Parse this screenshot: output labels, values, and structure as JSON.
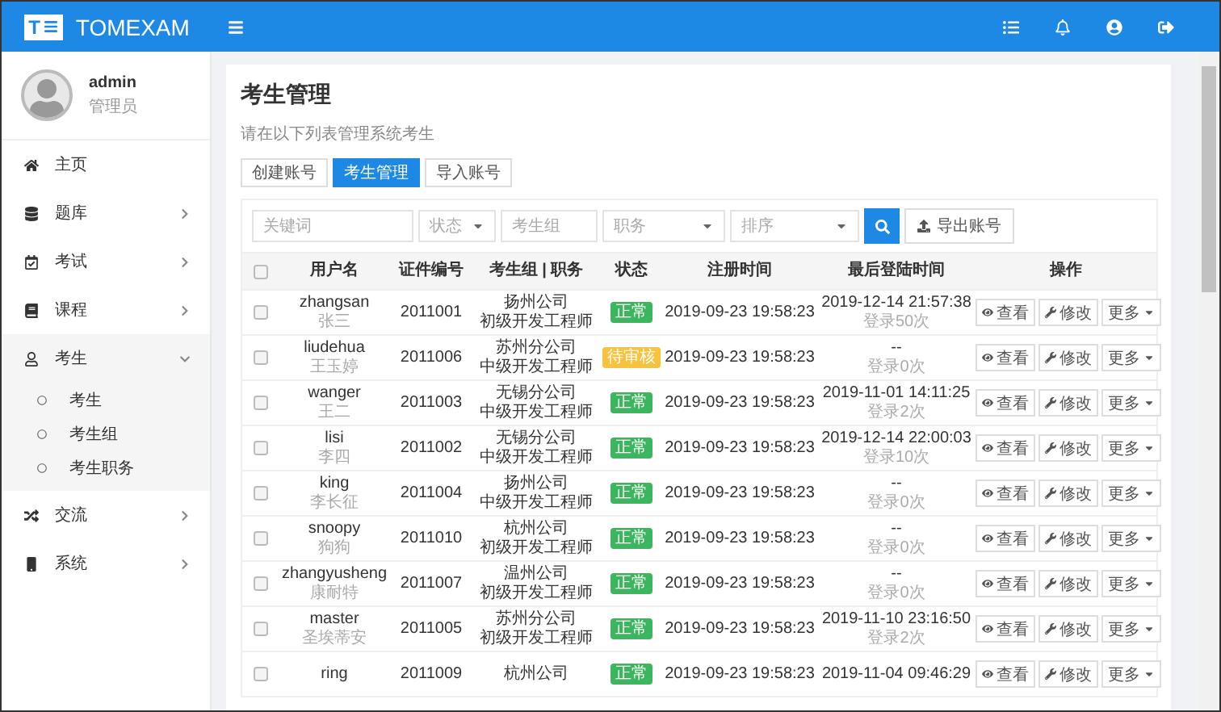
{
  "topbar": {
    "logo": "T",
    "brand": "TOMEXAM"
  },
  "sidebar": {
    "user": {
      "name": "admin",
      "role": "管理员"
    },
    "items": [
      {
        "label": "主页",
        "has_arrow": false
      },
      {
        "label": "题库",
        "has_arrow": true,
        "expanded": false
      },
      {
        "label": "考试",
        "has_arrow": true,
        "expanded": false
      },
      {
        "label": "课程",
        "has_arrow": true,
        "expanded": false
      },
      {
        "label": "考生",
        "has_arrow": true,
        "expanded": true,
        "children": [
          {
            "label": "考生"
          },
          {
            "label": "考生组"
          },
          {
            "label": "考生职务"
          }
        ]
      },
      {
        "label": "交流",
        "has_arrow": true,
        "expanded": false
      },
      {
        "label": "系统",
        "has_arrow": true,
        "expanded": false
      }
    ]
  },
  "page": {
    "title": "考生管理",
    "subtitle": "请在以下列表管理系统考生"
  },
  "tabs": [
    {
      "label": "创建账号",
      "selected": false
    },
    {
      "label": "考生管理",
      "selected": true
    },
    {
      "label": "导入账号",
      "selected": false
    }
  ],
  "filters": [
    {
      "kind": "input",
      "placeholder": "关键词"
    },
    {
      "kind": "select",
      "placeholder": "状态"
    },
    {
      "kind": "input",
      "placeholder": "考生组"
    },
    {
      "kind": "select",
      "placeholder": "职务"
    },
    {
      "kind": "select",
      "placeholder": "排序"
    }
  ],
  "export_button": "导出账号",
  "table": {
    "all_checked": false,
    "columns": [
      "用户名",
      "证件编号",
      "考生组 | 职务",
      "状态",
      "注册时间",
      "最后登陆时间",
      "操作"
    ],
    "rows": [
      {
        "checked": false,
        "username": "zhangsan",
        "name": "张三",
        "id": "2011001",
        "group": "扬州公司",
        "position": "初级开发工程师",
        "status": {
          "label": "正常",
          "kind": "normal"
        },
        "registered": "2019-09-23 19:58:23",
        "last_login": "2019-12-14 21:57:38",
        "login_count": "登录50次",
        "actions": [
          "查看",
          "修改",
          "更多"
        ]
      },
      {
        "checked": false,
        "username": "liudehua",
        "name": "王玉婷",
        "id": "2011006",
        "group": "苏州分公司",
        "position": "中级开发工程师",
        "status": {
          "label": "待审核",
          "kind": "pending"
        },
        "registered": "2019-09-23 19:58:23",
        "last_login": "--",
        "login_count": "登录0次",
        "actions": [
          "查看",
          "修改",
          "更多"
        ]
      },
      {
        "checked": false,
        "username": "wanger",
        "name": "王二",
        "id": "2011003",
        "group": "无锡分公司",
        "position": "中级开发工程师",
        "status": {
          "label": "正常",
          "kind": "normal"
        },
        "registered": "2019-09-23 19:58:23",
        "last_login": "2019-11-01 14:11:25",
        "login_count": "登录2次",
        "actions": [
          "查看",
          "修改",
          "更多"
        ]
      },
      {
        "checked": false,
        "username": "lisi",
        "name": "李四",
        "id": "2011002",
        "group": "无锡分公司",
        "position": "中级开发工程师",
        "status": {
          "label": "正常",
          "kind": "normal"
        },
        "registered": "2019-09-23 19:58:23",
        "last_login": "2019-12-14 22:00:03",
        "login_count": "登录10次",
        "actions": [
          "查看",
          "修改",
          "更多"
        ]
      },
      {
        "checked": false,
        "username": "king",
        "name": "李长征",
        "id": "2011004",
        "group": "扬州公司",
        "position": "中级开发工程师",
        "status": {
          "label": "正常",
          "kind": "normal"
        },
        "registered": "2019-09-23 19:58:23",
        "last_login": "--",
        "login_count": "登录0次",
        "actions": [
          "查看",
          "修改",
          "更多"
        ]
      },
      {
        "checked": false,
        "username": "snoopy",
        "name": "狗狗",
        "id": "2011010",
        "group": "杭州公司",
        "position": "初级开发工程师",
        "status": {
          "label": "正常",
          "kind": "normal"
        },
        "registered": "2019-09-23 19:58:23",
        "last_login": "--",
        "login_count": "登录0次",
        "actions": [
          "查看",
          "修改",
          "更多"
        ]
      },
      {
        "checked": false,
        "username": "zhangyusheng",
        "name": "康耐特",
        "id": "2011007",
        "group": "温州公司",
        "position": "初级开发工程师",
        "status": {
          "label": "正常",
          "kind": "normal"
        },
        "registered": "2019-09-23 19:58:23",
        "last_login": "--",
        "login_count": "登录0次",
        "actions": [
          "查看",
          "修改",
          "更多"
        ]
      },
      {
        "checked": false,
        "username": "master",
        "name": "圣埃蒂安",
        "id": "2011005",
        "group": "苏州分公司",
        "position": "初级开发工程师",
        "status": {
          "label": "正常",
          "kind": "normal"
        },
        "registered": "2019-09-23 19:58:23",
        "last_login": "2019-11-10 23:16:50",
        "login_count": "登录2次",
        "actions": [
          "查看",
          "修改",
          "更多"
        ]
      },
      {
        "checked": false,
        "username": "ring",
        "id": "2011009",
        "group": "杭州公司",
        "status": {
          "label": "正常",
          "kind": "normal"
        },
        "registered": "2019-09-23 19:58:23",
        "last_login": "2019-11-04 09:46:29",
        "actions": [
          "查看",
          "修改",
          "更多"
        ]
      }
    ]
  }
}
